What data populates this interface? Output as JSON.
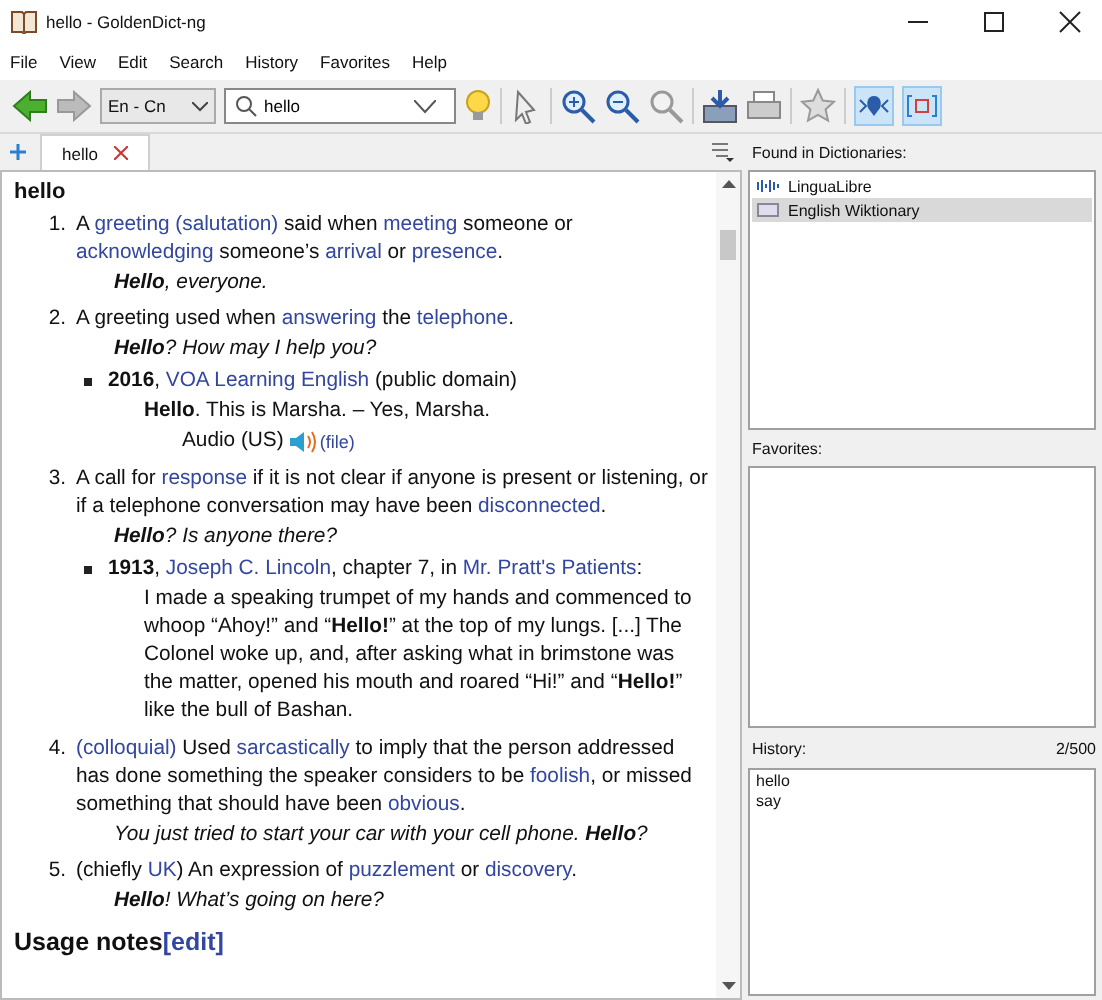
{
  "window": {
    "title": "hello - GoldenDict-ng"
  },
  "menu": [
    "File",
    "View",
    "Edit",
    "Search",
    "History",
    "Favorites",
    "Help"
  ],
  "toolbar": {
    "language": "En - Cn",
    "search": {
      "value": "hello"
    },
    "toggles": [
      {
        "kind": "pronounce",
        "on": true
      },
      {
        "kind": "dictbar",
        "on": true
      }
    ]
  },
  "tabs": [
    {
      "label": "hello",
      "selected": true
    }
  ],
  "article": {
    "headword": "hello",
    "definitions": [
      {
        "number": "1.",
        "segments": [
          {
            "kind": "text",
            "text": "A "
          },
          {
            "kind": "link",
            "text": "greeting (salutation)"
          },
          {
            "kind": "text",
            "text": " said when "
          },
          {
            "kind": "link",
            "text": "meeting"
          },
          {
            "kind": "text",
            "text": " someone or "
          },
          {
            "kind": "link",
            "text": "acknowledging"
          },
          {
            "kind": "text",
            "text": " someone’s "
          },
          {
            "kind": "link",
            "text": "arrival"
          },
          {
            "kind": "text",
            "text": " or "
          },
          {
            "kind": "link",
            "text": "presence"
          },
          {
            "kind": "text",
            "text": "."
          }
        ],
        "parts": [
          {
            "kind": "usage",
            "text": "**Hello**, everyone."
          }
        ]
      },
      {
        "number": "2.",
        "segments": [
          {
            "kind": "text",
            "text": "A greeting used when "
          },
          {
            "kind": "link",
            "text": "answering"
          },
          {
            "kind": "text",
            "text": " the "
          },
          {
            "kind": "link",
            "text": "telephone"
          },
          {
            "kind": "text",
            "text": "."
          }
        ],
        "parts": [
          {
            "kind": "usage",
            "text": "**Hello**? How may I help you?"
          },
          {
            "kind": "quote",
            "citation": [
              {
                "kind": "bold",
                "text": "2016"
              },
              {
                "kind": "text",
                "text": ", "
              },
              {
                "kind": "link",
                "text": "VOA Learning English"
              },
              {
                "kind": "text",
                "text": " (public domain)"
              }
            ],
            "passage": "**Hello**. This is Marsha. – Yes, Marsha.",
            "audio": {
              "label": "Audio (US)",
              "link": "(file)"
            }
          }
        ]
      },
      {
        "number": "3.",
        "segments": [
          {
            "kind": "text",
            "text": "A call for "
          },
          {
            "kind": "link",
            "text": "response"
          },
          {
            "kind": "text",
            "text": " if it is not clear if anyone is present or listening, or if a telephone conversation may have been "
          },
          {
            "kind": "link",
            "text": "disconnected"
          },
          {
            "kind": "text",
            "text": "."
          }
        ],
        "parts": [
          {
            "kind": "usage",
            "text": "**Hello**? Is anyone there?"
          },
          {
            "kind": "quote",
            "citation": [
              {
                "kind": "bold",
                "text": "1913"
              },
              {
                "kind": "text",
                "text": ", "
              },
              {
                "kind": "link",
                "text": "Joseph C. Lincoln"
              },
              {
                "kind": "text",
                "text": ", chapter 7, in "
              },
              {
                "kind": "link",
                "text": "Mr. Pratt's Patients"
              },
              {
                "kind": "text",
                "text": ":"
              }
            ],
            "passage": "I made a speaking trumpet of my hands and commenced to whoop “Ahoy!” and “**Hello!**” at the top of my lungs. [...] The Colonel woke up, and, after asking what in brimstone was the matter, opened his mouth and roared “Hi!” and “**Hello!**” like the bull of Bashan."
          }
        ]
      },
      {
        "number": "4.",
        "segments": [
          {
            "kind": "link",
            "text": "(colloquial)"
          },
          {
            "kind": "text",
            "text": " Used "
          },
          {
            "kind": "link",
            "text": "sarcastically"
          },
          {
            "kind": "text",
            "text": " to imply that the person addressed has done something the speaker considers to be "
          },
          {
            "kind": "link",
            "text": "foolish"
          },
          {
            "kind": "text",
            "text": ", or missed something that should have been "
          },
          {
            "kind": "link",
            "text": "obvious"
          },
          {
            "kind": "text",
            "text": "."
          }
        ],
        "parts": [
          {
            "kind": "usage",
            "text": "You just tried to start your car with your cell phone. **Hello**?"
          }
        ]
      },
      {
        "number": "5.",
        "segments": [
          {
            "kind": "text",
            "text": "(chiefly "
          },
          {
            "kind": "link",
            "text": "UK"
          },
          {
            "kind": "text",
            "text": ") An expression of "
          },
          {
            "kind": "link",
            "text": "puzzlement"
          },
          {
            "kind": "text",
            "text": " or "
          },
          {
            "kind": "link",
            "text": "discovery"
          },
          {
            "kind": "text",
            "text": "."
          }
        ],
        "parts": [
          {
            "kind": "usage",
            "text": "**Hello**! What’s going on here?"
          }
        ]
      }
    ],
    "section": {
      "title": "Usage notes",
      "edit": "[edit]"
    }
  },
  "found": {
    "title": "Found in Dictionaries:",
    "items": [
      {
        "name": "LinguaLibre",
        "kind": "audio",
        "selected": false
      },
      {
        "name": "English Wiktionary",
        "kind": "wiki",
        "selected": true
      }
    ]
  },
  "favorites": {
    "title": "Favorites:"
  },
  "history": {
    "title": "History:",
    "count": "2/500",
    "items": [
      "hello",
      "say"
    ]
  }
}
